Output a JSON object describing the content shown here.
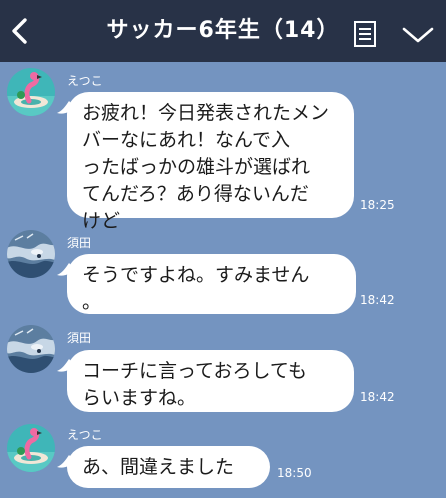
{
  "header": {
    "back_icon": "chevron-left-icon",
    "title": "サッカー6年生（14）",
    "menu_icon": "notes-menu-icon",
    "expand_icon": "chevron-down-icon",
    "background": "#283247"
  },
  "chat": {
    "background": "#7494c0",
    "bubble_color": "#ffffff",
    "messages": [
      {
        "sender": "えつこ",
        "avatar": "flamingo-float-avatar",
        "text": "お疲れ！今日発表されたメン\nバーなにあれ！なんで入\nったばっかの雄斗が選ばれ\nてんだろ？あり得ないんだ\nけど",
        "time": "18:25"
      },
      {
        "sender": "須田",
        "avatar": "splash-photo-avatar",
        "text": "そうですよね。すみません\n。",
        "time": "18:42"
      },
      {
        "sender": "須田",
        "avatar": "splash-photo-avatar",
        "text": "コーチに言っておろしても\nらいますね。",
        "time": "18:42"
      },
      {
        "sender": "えつこ",
        "avatar": "flamingo-float-avatar",
        "text": "あ、間違えました",
        "time": "18:50"
      }
    ]
  }
}
